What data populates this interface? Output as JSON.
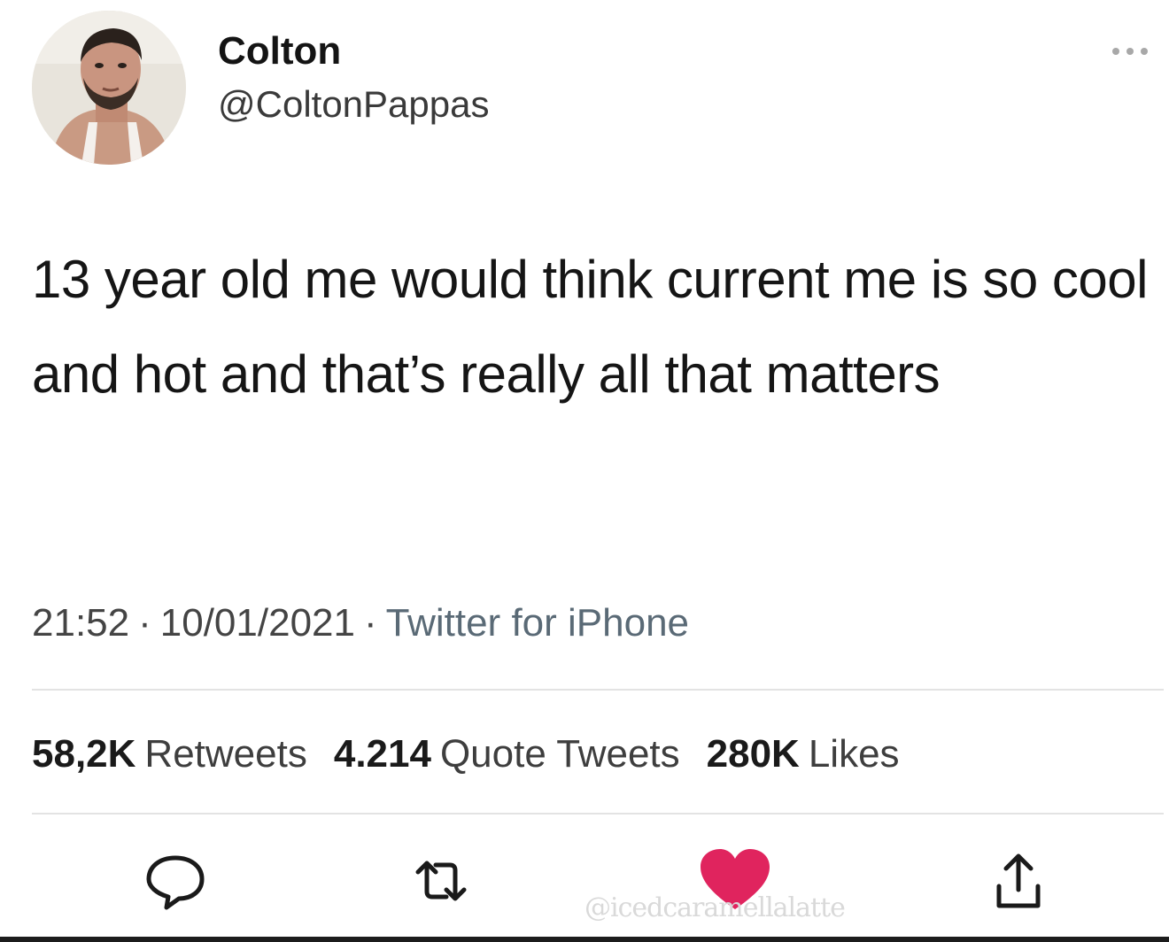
{
  "user": {
    "name": "Colton",
    "handle": "@ColtonPappas"
  },
  "tweet": {
    "text": "13 year old me would think current me is so cool and hot and that’s really all that matters",
    "time": "21:52",
    "date": "10/01/2021",
    "separator": "·",
    "source": "Twitter for iPhone"
  },
  "stats": {
    "retweets_count": "58,2K",
    "retweets_label": "Retweets",
    "quotes_count": "4.214",
    "quotes_label": "Quote Tweets",
    "likes_count": "280K",
    "likes_label": "Likes"
  },
  "actions": [
    {
      "icon": "reply-icon"
    },
    {
      "icon": "retweet-icon"
    },
    {
      "icon": "heart-icon",
      "liked": true,
      "color": "#e0245e"
    },
    {
      "icon": "share-icon"
    }
  ],
  "watermark": "@icedcaramellalatte",
  "colors": {
    "like_active": "#e0245e",
    "text_primary": "#151515",
    "text_secondary": "#444444",
    "divider": "#e3e3e3"
  }
}
